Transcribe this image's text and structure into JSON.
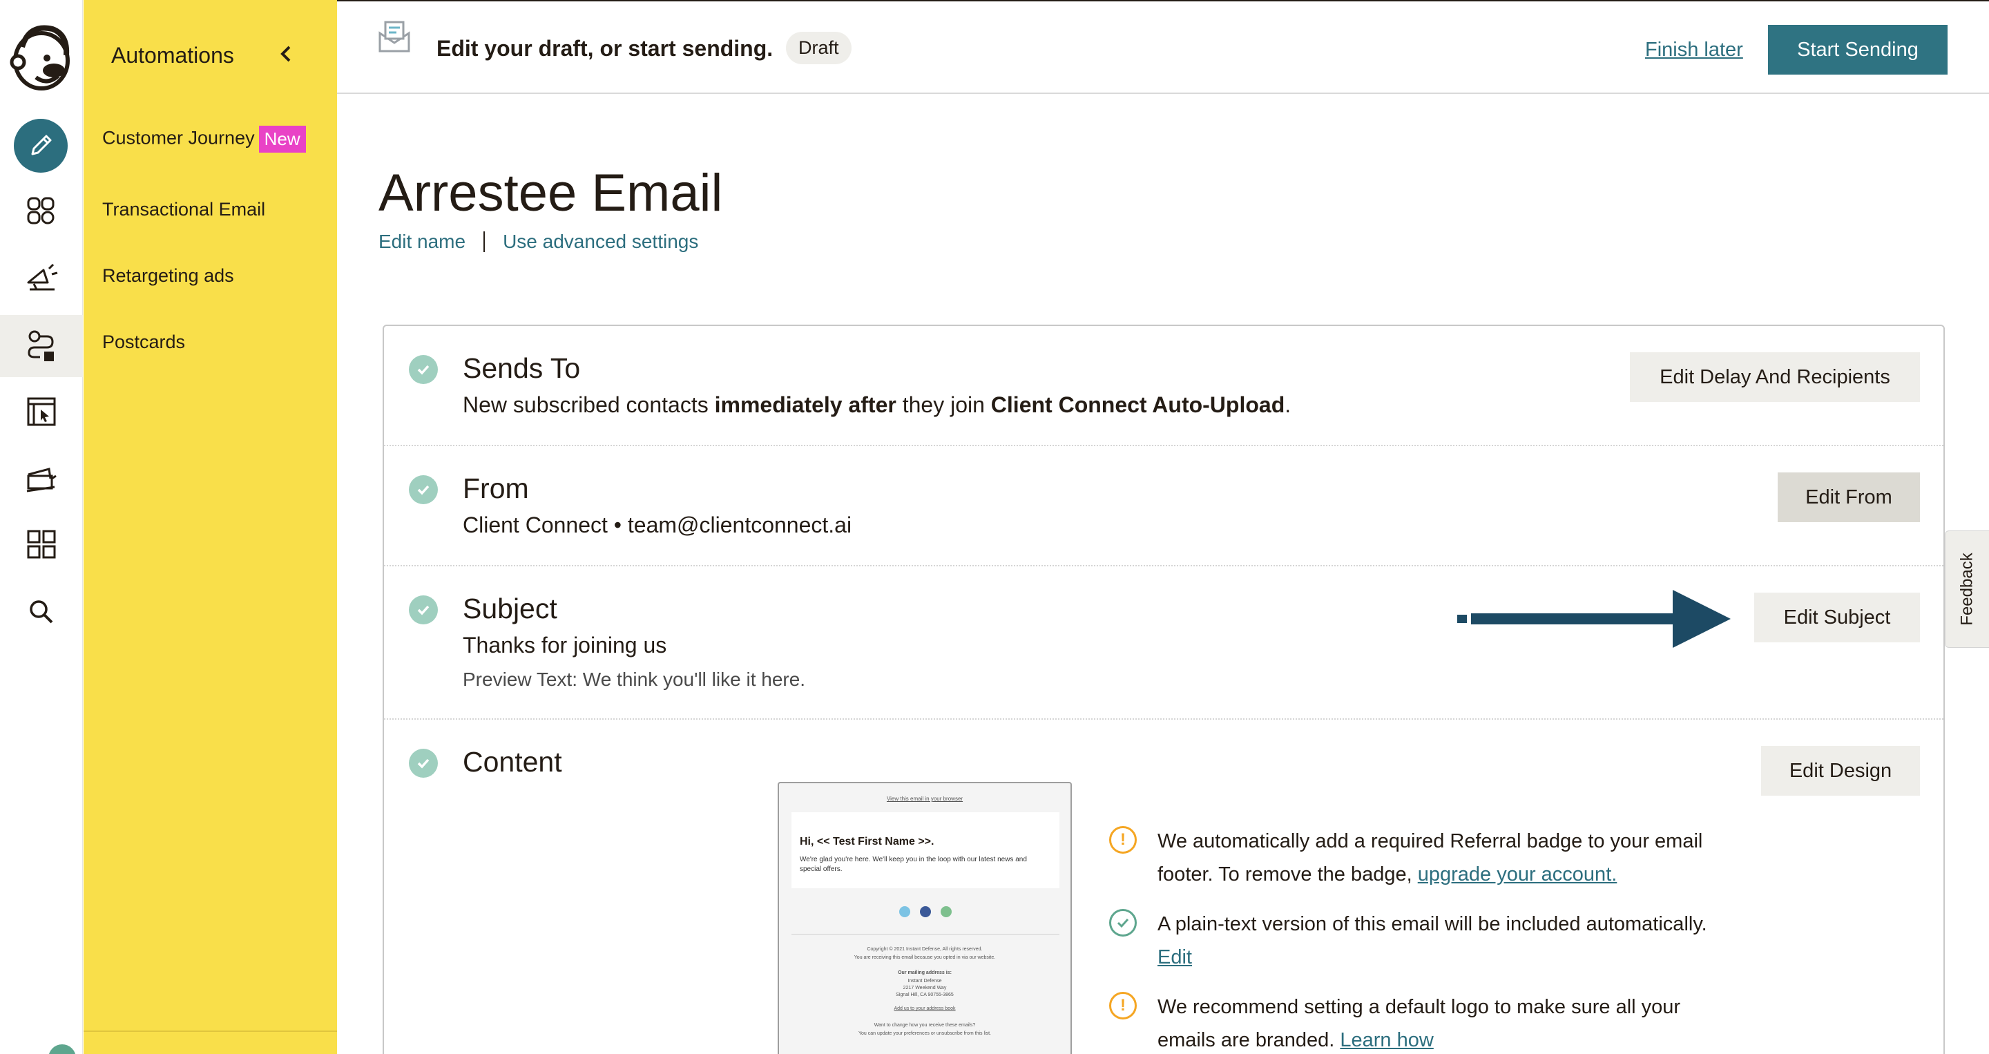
{
  "sidebar": {
    "heading": "Automations",
    "items": [
      {
        "label": "Customer Journey",
        "badge": "New"
      },
      {
        "label": "Transactional Email"
      },
      {
        "label": "Retargeting ads"
      },
      {
        "label": "Postcards"
      }
    ]
  },
  "header": {
    "title": "Edit your draft, or start sending.",
    "status_badge": "Draft",
    "finish_later": "Finish later",
    "start_sending": "Start Sending"
  },
  "page": {
    "title": "Arrestee Email",
    "edit_name": "Edit name",
    "advanced_settings": "Use advanced settings"
  },
  "checklist": {
    "sends_to": {
      "title": "Sends To",
      "text_1": "New subscribed contacts ",
      "text_bold_1": "immediately after",
      "text_2": " they join ",
      "text_bold_2": "Client Connect Auto-Upload",
      "text_3": ".",
      "button": "Edit Delay And Recipients"
    },
    "from": {
      "title": "From",
      "value": "Client Connect • team@clientconnect.ai",
      "button": "Edit From"
    },
    "subject": {
      "title": "Subject",
      "value": "Thanks for joining us",
      "preview": "Preview Text: We think you'll like it here.",
      "button": "Edit Subject"
    },
    "content": {
      "title": "Content",
      "button": "Edit Design",
      "thumbnail": {
        "view_in_browser": "View this email in your browser",
        "greeting": "Hi, << Test First Name >>.",
        "body": "We're glad you're here. We'll keep you in the loop with our latest news and special offers.",
        "copyright": "Copyright © 2021 Instant Defense, All rights reserved.",
        "reason": "You are receiving this email because you opted in via our website.",
        "mailing_heading": "Our mailing address is:",
        "address_1": "Instant Defense",
        "address_2": "2217 Weekend Way",
        "address_3": "Signal Hill, CA 90755-3865",
        "add_book": "Add us to your address book",
        "change_q": "Want to change how you receive these emails?",
        "change_a": "You can update your preferences or unsubscribe from this list."
      },
      "notices": [
        {
          "type": "warning",
          "text": "We automatically add a required Referral badge to your email footer. To remove the badge, ",
          "link": "upgrade your account."
        },
        {
          "type": "ok",
          "text": "A plain-text version of this email will be included automatically. ",
          "link": "Edit"
        },
        {
          "type": "warning",
          "text": "We recommend setting a default logo to make sure all your emails are branded. ",
          "link": "Learn how"
        }
      ]
    }
  },
  "feedback_tab": "Feedback",
  "colors": {
    "sidebar_yellow": "#f9df4a",
    "primary_teal": "#2f7382",
    "new_badge_pink": "#e942c6",
    "check_green": "#9fcfbf",
    "warning_orange": "#f5a623",
    "arrow_navy": "#1d4a64"
  }
}
